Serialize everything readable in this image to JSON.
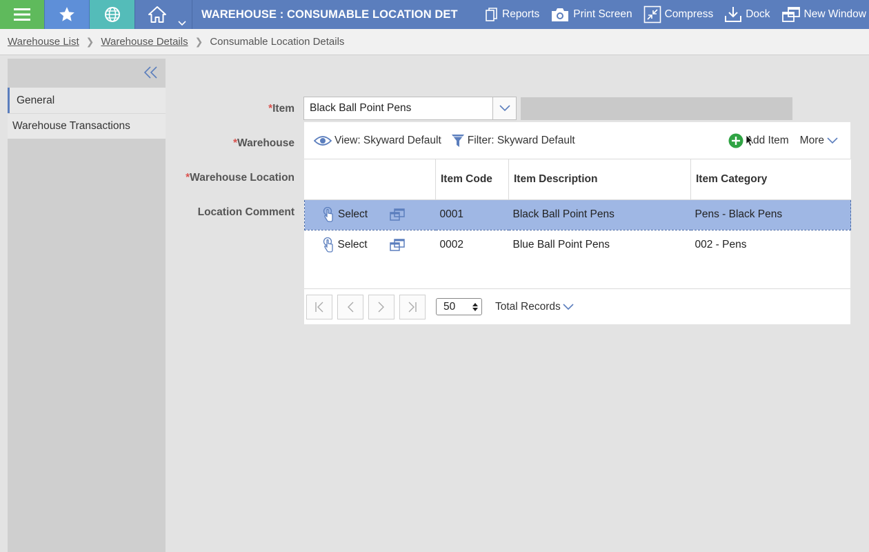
{
  "topbar": {
    "title": "WAREHOUSE : CONSUMABLE LOCATION DET",
    "actions": [
      {
        "label": "Reports",
        "icon": "document-copy-icon"
      },
      {
        "label": "Print Screen",
        "icon": "camera-icon"
      },
      {
        "label": "Compress",
        "icon": "compress-icon"
      },
      {
        "label": "Dock",
        "icon": "dock-icon"
      },
      {
        "label": "New Window",
        "icon": "new-window-icon"
      }
    ],
    "colors": {
      "menu": "#5fba5c",
      "favorites": "#5e8fd8",
      "globe": "#54bcb9",
      "bar": "#5b7ebd"
    }
  },
  "breadcrumb": {
    "items": [
      "Warehouse List",
      "Warehouse Details"
    ],
    "current": "Consumable Location Details"
  },
  "sidebar": {
    "items": [
      {
        "label": "General",
        "active": true
      },
      {
        "label": "Warehouse Transactions",
        "active": false
      }
    ]
  },
  "form": {
    "labels": {
      "item": "Item",
      "warehouse": "Warehouse",
      "warehouse_location": "Warehouse Location",
      "location_comment": "Location Comment"
    },
    "required_mark": "*",
    "item_value": "Black Ball Point Pens"
  },
  "grid": {
    "view": "View: Skyward Default",
    "filter": "Filter: Skyward Default",
    "add_item": "Add Item",
    "more": "More",
    "columns": [
      "",
      "Item Code",
      "Item Description",
      "Item Category"
    ],
    "select_label": "Select",
    "rows": [
      {
        "code": "0001",
        "description": "Black Ball Point Pens",
        "category": "Pens - Black Pens",
        "selected": true
      },
      {
        "code": "0002",
        "description": "Blue Ball Point Pens",
        "category": "002 - Pens",
        "selected": false
      }
    ],
    "page_size": "50",
    "total_records": "Total Records"
  }
}
